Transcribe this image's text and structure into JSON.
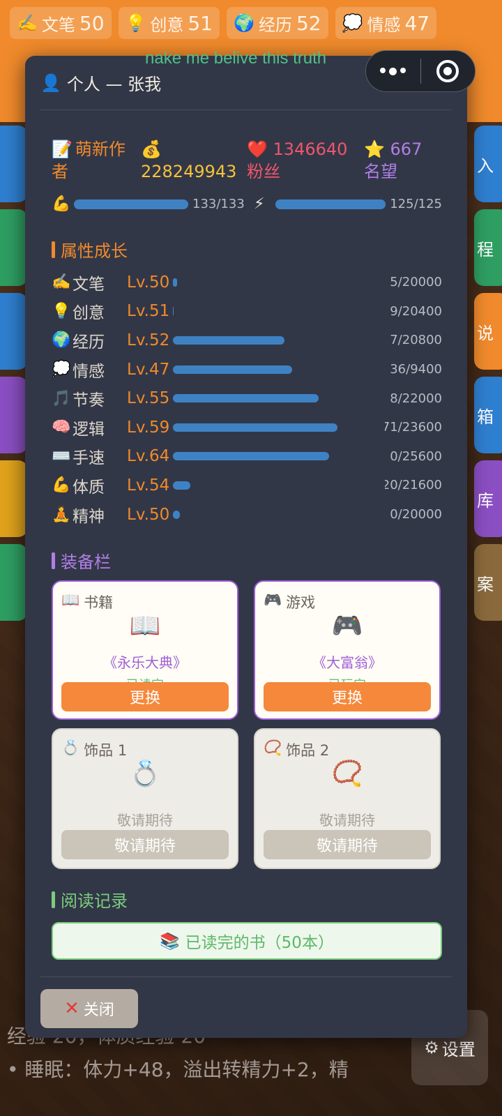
{
  "background": {
    "top_stats": [
      {
        "icon": "✍️",
        "label": "文笔",
        "value": "50"
      },
      {
        "icon": "💡",
        "label": "创意",
        "value": "51"
      },
      {
        "icon": "🌍",
        "label": "经历",
        "value": "52"
      },
      {
        "icon": "💭",
        "label": "情感",
        "value": "47"
      }
    ],
    "right_tabs": [
      "入",
      "程",
      "说",
      "箱",
      "库",
      "案"
    ],
    "bottom_lines": [
      "经验 20，体质经验 20",
      "• 睡眠：体力+48，溢出转精力+2，精"
    ],
    "settings_label": "设置",
    "settings_icon": "gear-icon"
  },
  "caption": "nake me belive this truth",
  "modal": {
    "title_icon": "👤",
    "title": "个人 — 张我",
    "close_symbol": "✕",
    "stats": {
      "role_icon": "📝",
      "role": "萌新作者",
      "money_icon": "💰",
      "money": "228249943",
      "fans_icon": "❤️",
      "fans": "1346640",
      "fans_label": "粉丝",
      "fame_icon": "⭐",
      "fame": "667",
      "fame_label": "名望"
    },
    "vitals": [
      {
        "icon": "💪",
        "text": "133/133",
        "ratio": 1.0
      },
      {
        "icon": "⚡",
        "text": "125/125",
        "ratio": 1.0
      }
    ],
    "attr_title": "属性成长",
    "attributes": [
      {
        "icon": "✍️",
        "name": "文笔",
        "level": "Lv.50",
        "progress": "5/20000",
        "ratio": 0.015
      },
      {
        "icon": "💡",
        "name": "创意",
        "level": "Lv.51",
        "progress": "9/20400",
        "ratio": 0.003
      },
      {
        "icon": "🌍",
        "name": "经历",
        "level": "Lv.52",
        "progress": "7/20800",
        "ratio": 0.42
      },
      {
        "icon": "💭",
        "name": "情感",
        "level": "Lv.47",
        "progress": "36/9400",
        "ratio": 0.45
      },
      {
        "icon": "🎵",
        "name": "节奏",
        "level": "Lv.55",
        "progress": "8/22000",
        "ratio": 0.55
      },
      {
        "icon": "🧠",
        "name": "逻辑",
        "level": "Lv.59",
        "progress": "71/23600",
        "ratio": 0.62
      },
      {
        "icon": "⌨️",
        "name": "手速",
        "level": "Lv.64",
        "progress": "0/25600",
        "ratio": 0.59
      },
      {
        "icon": "💪",
        "name": "体质",
        "level": "Lv.54",
        "progress": "20/21600",
        "ratio": 0.065
      },
      {
        "icon": "🧘",
        "name": "精神",
        "level": "Lv.50",
        "progress": "0/20000",
        "ratio": 0.025
      }
    ],
    "equip_title": "装备栏",
    "equipment": [
      {
        "slot_icon": "📖",
        "slot": "书籍",
        "item_icon": "📖",
        "item": "《永乐大典》",
        "status": "已读完",
        "button": "更换"
      },
      {
        "slot_icon": "🎮",
        "slot": "游戏",
        "item_icon": "🎮",
        "item": "《大富翁》",
        "status": "已玩完",
        "button": "更换"
      },
      {
        "slot_icon": "💍",
        "slot": "饰品 1",
        "item_icon": "💍",
        "soon": "敬请期待",
        "button": "敬请期待"
      },
      {
        "slot_icon": "📿",
        "slot": "饰品 2",
        "item_icon": "📿",
        "soon": "敬请期待",
        "button": "敬请期待"
      }
    ],
    "reading_title": "阅读记录",
    "reading_icon": "📚",
    "reading_button": "已读完的书（50本）",
    "close_icon": "✕",
    "close_label": "关闭"
  },
  "colors": {
    "accent_orange": "#f08a2c",
    "progress_blue": "#3f82c4",
    "equip_purple": "#9d5fd6",
    "read_green": "#5db86a",
    "modal_bg": "#323747"
  }
}
